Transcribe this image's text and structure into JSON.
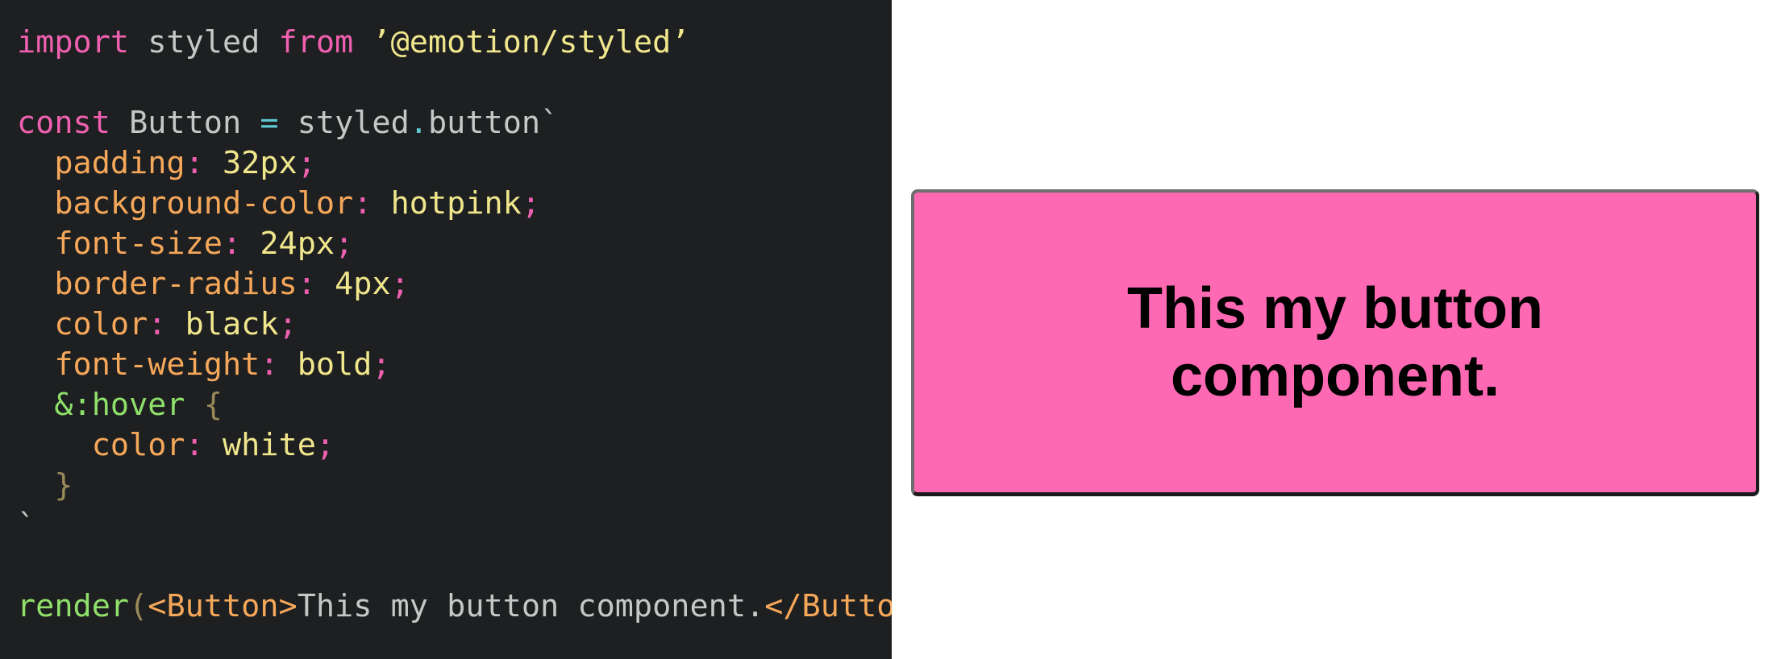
{
  "editor": {
    "lines": [
      [
        [
          "kw",
          "import"
        ],
        [
          "id",
          " styled "
        ],
        [
          "kw",
          "from"
        ],
        [
          "id",
          " "
        ],
        [
          "str",
          "’@emotion/styled’"
        ]
      ],
      [],
      [
        [
          "kw",
          "const"
        ],
        [
          "id",
          " Button "
        ],
        [
          "op",
          "="
        ],
        [
          "id",
          " styled"
        ],
        [
          "op",
          "."
        ],
        [
          "id",
          "button"
        ],
        [
          "tick",
          "`"
        ]
      ],
      [
        [
          "id",
          "  "
        ],
        [
          "prop",
          "padding"
        ],
        [
          "punct",
          ":"
        ],
        [
          "id",
          " "
        ],
        [
          "val",
          "32px"
        ],
        [
          "punct",
          ";"
        ]
      ],
      [
        [
          "id",
          "  "
        ],
        [
          "prop",
          "background-color"
        ],
        [
          "punct",
          ":"
        ],
        [
          "id",
          " "
        ],
        [
          "val",
          "hotpink"
        ],
        [
          "punct",
          ";"
        ]
      ],
      [
        [
          "id",
          "  "
        ],
        [
          "prop",
          "font-size"
        ],
        [
          "punct",
          ":"
        ],
        [
          "id",
          " "
        ],
        [
          "val",
          "24px"
        ],
        [
          "punct",
          ";"
        ]
      ],
      [
        [
          "id",
          "  "
        ],
        [
          "prop",
          "border-radius"
        ],
        [
          "punct",
          ":"
        ],
        [
          "id",
          " "
        ],
        [
          "val",
          "4px"
        ],
        [
          "punct",
          ";"
        ]
      ],
      [
        [
          "id",
          "  "
        ],
        [
          "prop",
          "color"
        ],
        [
          "punct",
          ":"
        ],
        [
          "id",
          " "
        ],
        [
          "val",
          "black"
        ],
        [
          "punct",
          ";"
        ]
      ],
      [
        [
          "id",
          "  "
        ],
        [
          "prop",
          "font-weight"
        ],
        [
          "punct",
          ":"
        ],
        [
          "id",
          " "
        ],
        [
          "val",
          "bold"
        ],
        [
          "punct",
          ";"
        ]
      ],
      [
        [
          "id",
          "  "
        ],
        [
          "sel",
          "&:hover"
        ],
        [
          "id",
          " "
        ],
        [
          "brace",
          "{"
        ]
      ],
      [
        [
          "id",
          "    "
        ],
        [
          "prop",
          "color"
        ],
        [
          "punct",
          ":"
        ],
        [
          "id",
          " "
        ],
        [
          "val",
          "white"
        ],
        [
          "punct",
          ";"
        ]
      ],
      [
        [
          "id",
          "  "
        ],
        [
          "brace",
          "}"
        ]
      ],
      [
        [
          "tick",
          "`"
        ]
      ],
      [],
      [
        [
          "fn",
          "render"
        ],
        [
          "paren",
          "("
        ],
        [
          "tag",
          "<Button>"
        ],
        [
          "text",
          "This my button component."
        ],
        [
          "tag",
          "</Button>"
        ],
        [
          "paren",
          ")"
        ]
      ]
    ]
  },
  "preview": {
    "button_label": "This my button component."
  },
  "colors": {
    "editor_background": "#1d1f21",
    "button_background": "#ff69b4",
    "button_text": "#000000"
  }
}
